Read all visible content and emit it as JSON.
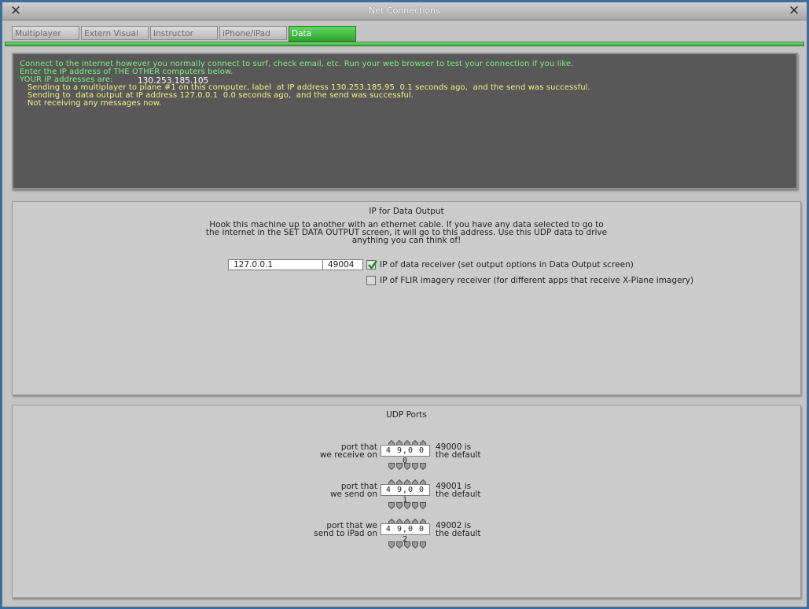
{
  "window": {
    "title": "Net Connections"
  },
  "tabs": [
    {
      "label": "Multiplayer",
      "active": false
    },
    {
      "label": "Extern Visual",
      "active": false
    },
    {
      "label": "Instructor",
      "active": false
    },
    {
      "label": "iPhone/iPad",
      "active": false
    },
    {
      "label": "Data",
      "active": true
    }
  ],
  "console": {
    "line1": "Connect to the internet however you normally connect to surf, check email, etc. Run your web browser to test your connection if you like.",
    "line2": "Enter the IP address of THE OTHER computers below.",
    "line3": "YOUR IP addresses are:",
    "ip": "130.253.185.105",
    "line4": "   Sending to a multiplayer to plane #1 on this computer, label  at IP address 130.253.185.95  0.1 seconds ago,  and the send was successful.",
    "line5": "   Sending to  data output at IP address 127.0.0.1  0.0 seconds ago,  and the send was successful.",
    "line6": "   Not receiving any messages now."
  },
  "data_output": {
    "title": "IP for Data Output",
    "desc1": "Hook this machine up to another with an ethernet cable. If you have any data selected to go to",
    "desc2": "the internet in the SET DATA OUTPUT screen, it will go to this address. Use this UDP data to drive",
    "desc3": "anything you can think of!",
    "ip_value": "127.0.0.1",
    "port_value": "49004",
    "data_receiver_checked": true,
    "data_receiver_label": "IP of data receiver (set output options in Data Output screen)",
    "flir_checked": false,
    "flir_label": "IP of FLIR imagery receiver (for different apps that receive X-Plane imagery)"
  },
  "udp_ports": {
    "title": "UDP Ports",
    "rows": [
      {
        "label1": "port that",
        "label2": "we receive on",
        "value": "4 9,0 0 0",
        "default1": "49000 is",
        "default2": "the default"
      },
      {
        "label1": "port that",
        "label2": "we send on",
        "value": "4 9,0 0 1",
        "default1": "49001 is",
        "default2": "the default"
      },
      {
        "label1": "port that we",
        "label2": "send to iPad on",
        "value": "4 9,0 0 2",
        "default1": "49002 is",
        "default2": "the default"
      }
    ]
  },
  "icons": {
    "close": "close-icon",
    "check": "check-icon",
    "up": "arrow-up-icon",
    "down": "arrow-down-icon"
  },
  "colors": {
    "accent_green": "#2fa42f",
    "console_bg": "#585858",
    "console_green": "#7ff07f",
    "console_yellow": "#f2f28a"
  }
}
